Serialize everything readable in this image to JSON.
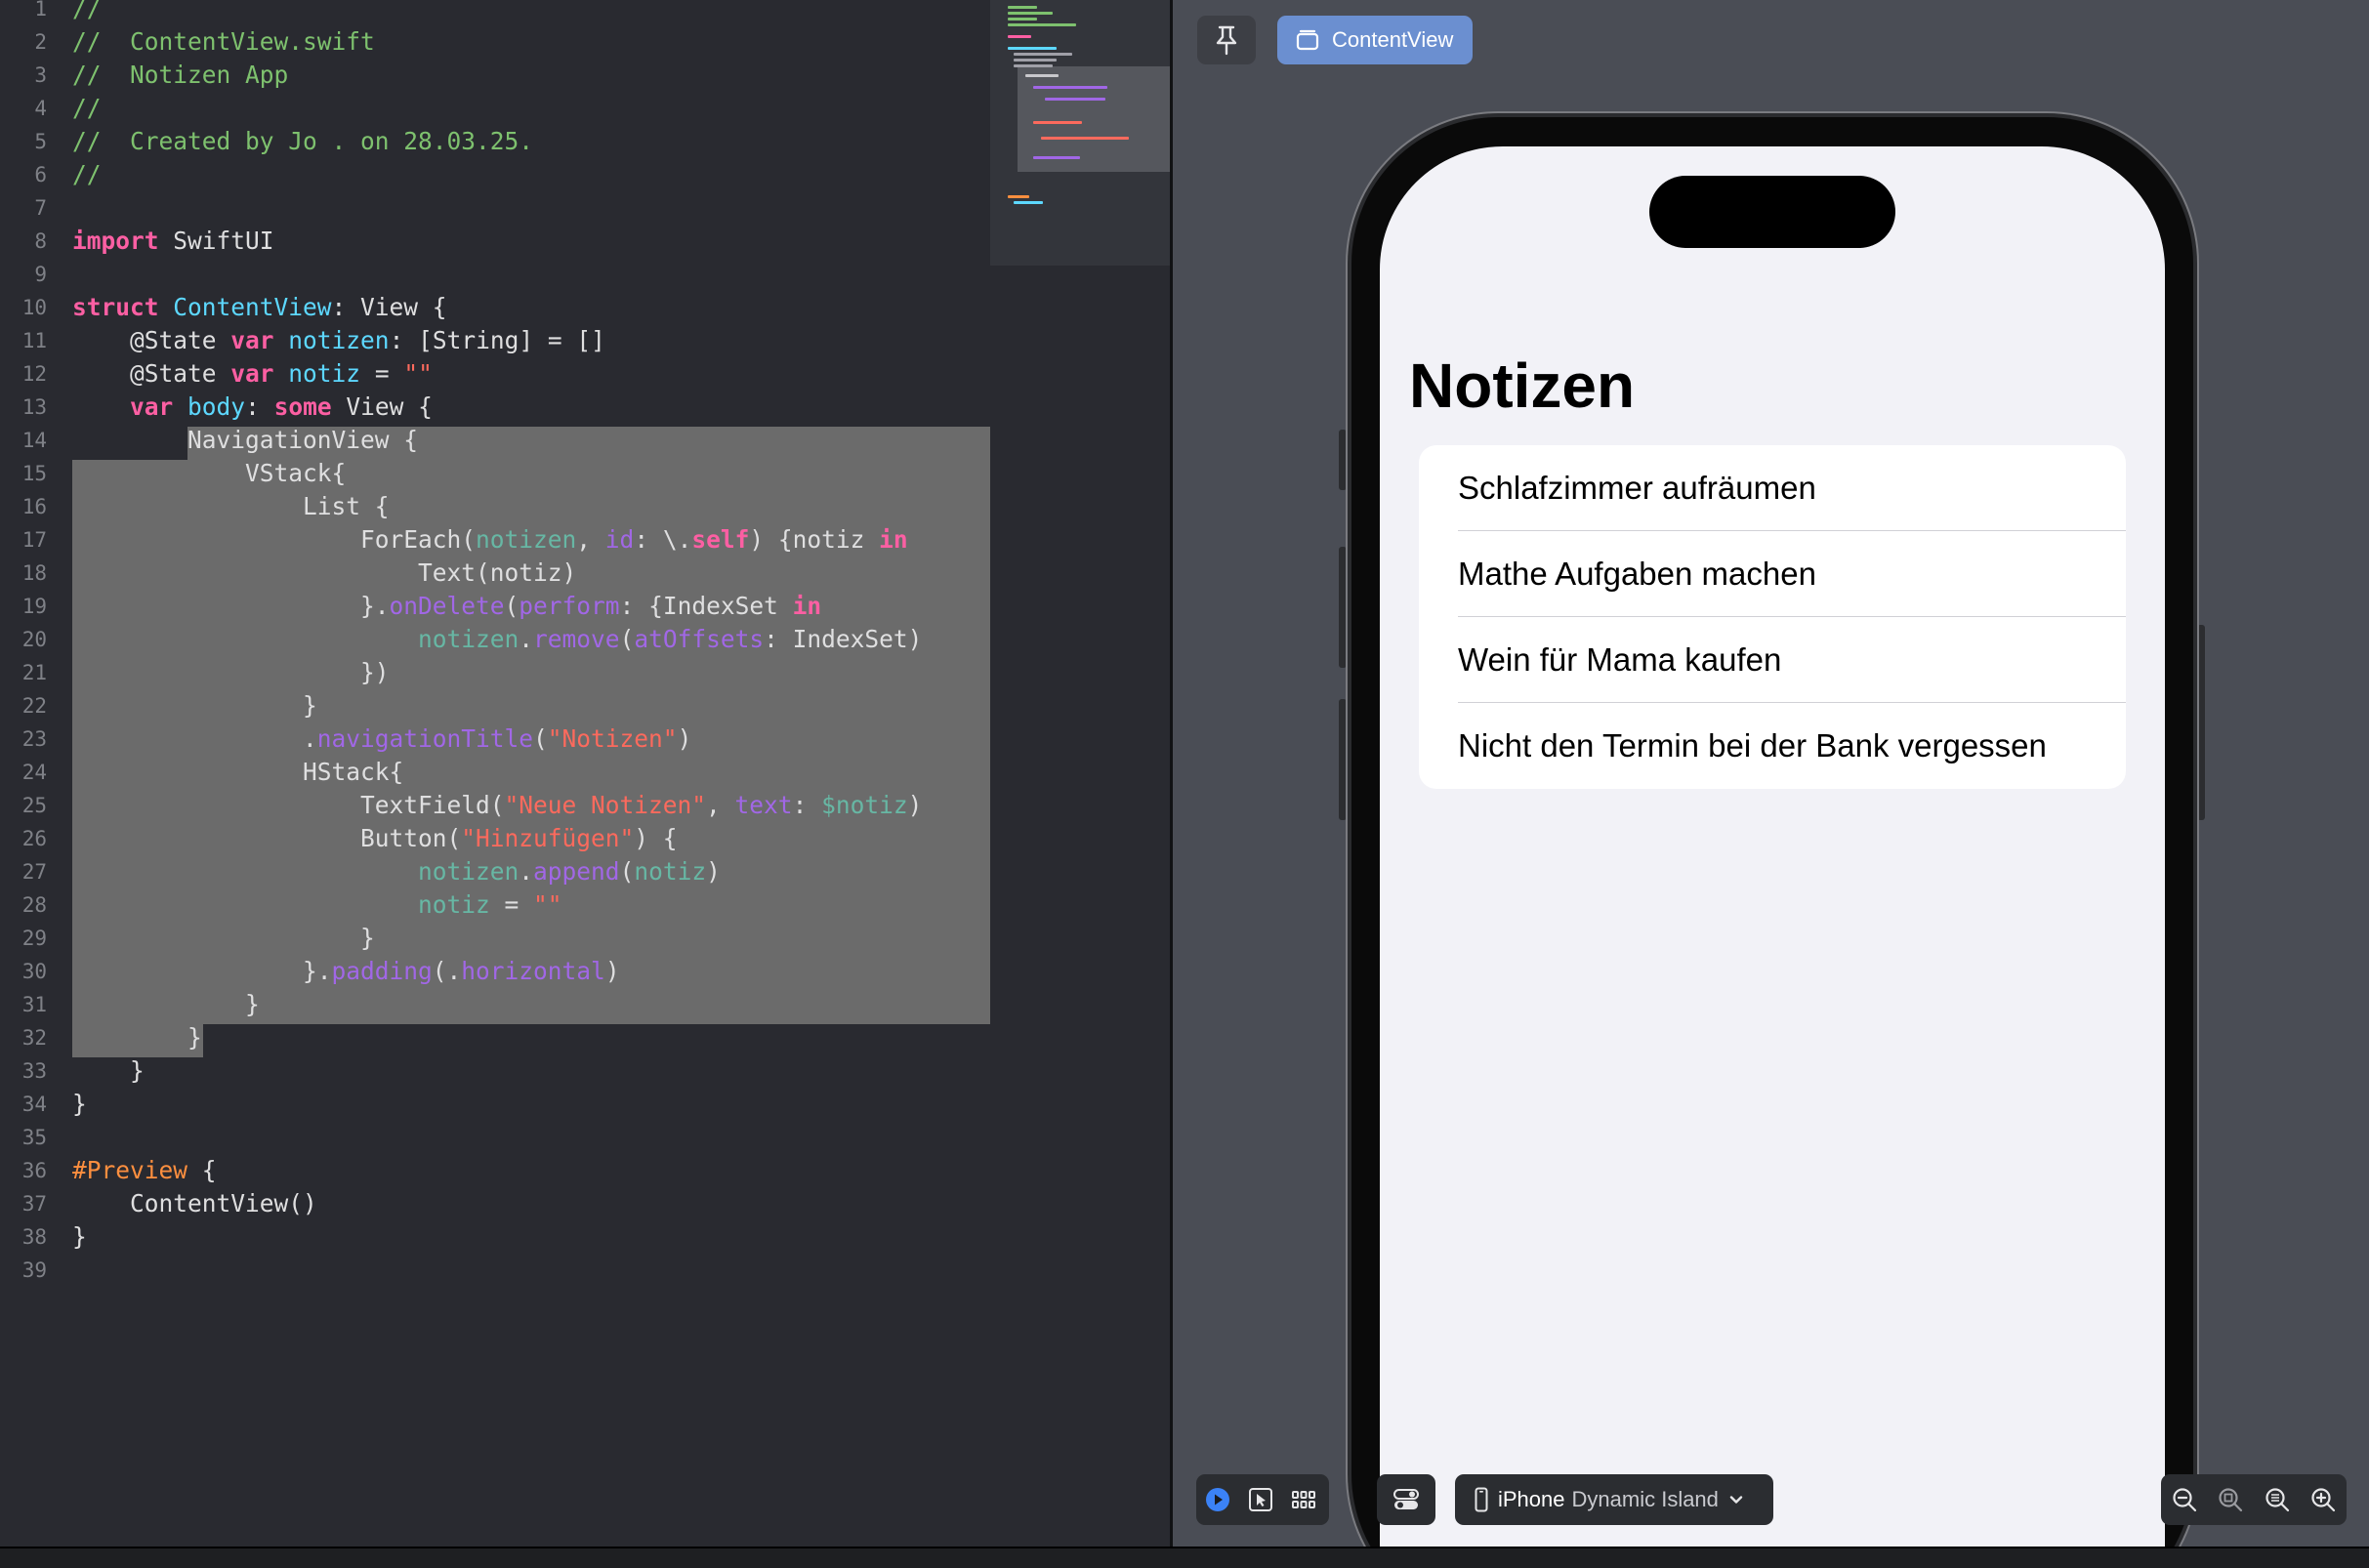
{
  "editor": {
    "file_name": "ContentView.swift",
    "lines": [
      {
        "n": "1",
        "tokens": [
          {
            "t": "//",
            "c": "cm"
          }
        ]
      },
      {
        "n": "2",
        "tokens": [
          {
            "t": "//  ContentView.swift",
            "c": "cm"
          }
        ]
      },
      {
        "n": "3",
        "tokens": [
          {
            "t": "//  Notizen App",
            "c": "cm"
          }
        ]
      },
      {
        "n": "4",
        "tokens": [
          {
            "t": "//",
            "c": "cm"
          }
        ]
      },
      {
        "n": "5",
        "tokens": [
          {
            "t": "//  Created by Jo . on 28.03.25.",
            "c": "cm"
          }
        ]
      },
      {
        "n": "6",
        "tokens": [
          {
            "t": "//",
            "c": "cm"
          }
        ]
      },
      {
        "n": "7",
        "tokens": []
      },
      {
        "n": "8",
        "tokens": [
          {
            "t": "import",
            "c": "kw"
          },
          {
            "t": " SwiftUI",
            "c": "pl"
          }
        ]
      },
      {
        "n": "9",
        "tokens": []
      },
      {
        "n": "10",
        "tokens": [
          {
            "t": "struct",
            "c": "kw"
          },
          {
            "t": " ",
            "c": "pl"
          },
          {
            "t": "ContentView",
            "c": "ty"
          },
          {
            "t": ": View {",
            "c": "pl"
          }
        ]
      },
      {
        "n": "11",
        "tokens": [
          {
            "t": "    @State ",
            "c": "pl"
          },
          {
            "t": "var",
            "c": "kw"
          },
          {
            "t": " ",
            "c": "pl"
          },
          {
            "t": "notizen",
            "c": "ty"
          },
          {
            "t": ": [String] = []",
            "c": "pl"
          }
        ]
      },
      {
        "n": "12",
        "tokens": [
          {
            "t": "    @State ",
            "c": "pl"
          },
          {
            "t": "var",
            "c": "kw"
          },
          {
            "t": " ",
            "c": "pl"
          },
          {
            "t": "notiz",
            "c": "ty"
          },
          {
            "t": " = ",
            "c": "pl"
          },
          {
            "t": "\"\"",
            "c": "st"
          }
        ]
      },
      {
        "n": "13",
        "tokens": [
          {
            "t": "    ",
            "c": "pl"
          },
          {
            "t": "var",
            "c": "kw"
          },
          {
            "t": " ",
            "c": "pl"
          },
          {
            "t": "body",
            "c": "ty"
          },
          {
            "t": ": ",
            "c": "pl"
          },
          {
            "t": "some",
            "c": "kw"
          },
          {
            "t": " View {",
            "c": "pl"
          }
        ]
      },
      {
        "n": "14",
        "tokens": [
          {
            "t": "        NavigationView {",
            "c": "pl"
          }
        ]
      },
      {
        "n": "15",
        "tokens": [
          {
            "t": "            VStack{",
            "c": "pl"
          }
        ]
      },
      {
        "n": "16",
        "tokens": [
          {
            "t": "                List {",
            "c": "pl"
          }
        ]
      },
      {
        "n": "17",
        "tokens": [
          {
            "t": "                    ForEach(",
            "c": "pl"
          },
          {
            "t": "notizen",
            "c": "vr"
          },
          {
            "t": ", ",
            "c": "pl"
          },
          {
            "t": "id",
            "c": "fn"
          },
          {
            "t": ": \\.",
            "c": "pl"
          },
          {
            "t": "self",
            "c": "kw"
          },
          {
            "t": ") {notiz ",
            "c": "pl"
          },
          {
            "t": "in",
            "c": "kw"
          }
        ]
      },
      {
        "n": "18",
        "tokens": [
          {
            "t": "                        Text(notiz)",
            "c": "pl"
          }
        ]
      },
      {
        "n": "19",
        "tokens": [
          {
            "t": "                    }.",
            "c": "pl"
          },
          {
            "t": "onDelete",
            "c": "fn"
          },
          {
            "t": "(",
            "c": "pl"
          },
          {
            "t": "perform",
            "c": "fn"
          },
          {
            "t": ": {IndexSet ",
            "c": "pl"
          },
          {
            "t": "in",
            "c": "kw"
          }
        ]
      },
      {
        "n": "20",
        "tokens": [
          {
            "t": "                        ",
            "c": "pl"
          },
          {
            "t": "notizen",
            "c": "vr"
          },
          {
            "t": ".",
            "c": "pl"
          },
          {
            "t": "remove",
            "c": "fn"
          },
          {
            "t": "(",
            "c": "pl"
          },
          {
            "t": "atOffsets",
            "c": "fn"
          },
          {
            "t": ": IndexSet)",
            "c": "pl"
          }
        ]
      },
      {
        "n": "21",
        "tokens": [
          {
            "t": "                    })",
            "c": "pl"
          }
        ]
      },
      {
        "n": "22",
        "tokens": [
          {
            "t": "                }",
            "c": "pl"
          }
        ]
      },
      {
        "n": "23",
        "tokens": [
          {
            "t": "                .",
            "c": "pl"
          },
          {
            "t": "navigationTitle",
            "c": "fn"
          },
          {
            "t": "(",
            "c": "pl"
          },
          {
            "t": "\"Notizen\"",
            "c": "st"
          },
          {
            "t": ")",
            "c": "pl"
          }
        ]
      },
      {
        "n": "24",
        "tokens": [
          {
            "t": "                HStack{",
            "c": "pl"
          }
        ]
      },
      {
        "n": "25",
        "tokens": [
          {
            "t": "                    TextField(",
            "c": "pl"
          },
          {
            "t": "\"Neue Notizen\"",
            "c": "st"
          },
          {
            "t": ", ",
            "c": "pl"
          },
          {
            "t": "text",
            "c": "fn"
          },
          {
            "t": ": ",
            "c": "pl"
          },
          {
            "t": "$notiz",
            "c": "vr"
          },
          {
            "t": ")",
            "c": "pl"
          }
        ]
      },
      {
        "n": "26",
        "tokens": [
          {
            "t": "                    Button(",
            "c": "pl"
          },
          {
            "t": "\"Hinzufügen\"",
            "c": "st"
          },
          {
            "t": ") {",
            "c": "pl"
          }
        ]
      },
      {
        "n": "27",
        "tokens": [
          {
            "t": "                        ",
            "c": "pl"
          },
          {
            "t": "notizen",
            "c": "vr"
          },
          {
            "t": ".",
            "c": "pl"
          },
          {
            "t": "append",
            "c": "fn"
          },
          {
            "t": "(",
            "c": "pl"
          },
          {
            "t": "notiz",
            "c": "vr"
          },
          {
            "t": ")",
            "c": "pl"
          }
        ]
      },
      {
        "n": "28",
        "tokens": [
          {
            "t": "                        ",
            "c": "pl"
          },
          {
            "t": "notiz",
            "c": "vr"
          },
          {
            "t": " = ",
            "c": "pl"
          },
          {
            "t": "\"\"",
            "c": "st"
          }
        ]
      },
      {
        "n": "29",
        "tokens": [
          {
            "t": "                    }",
            "c": "pl"
          }
        ]
      },
      {
        "n": "30",
        "tokens": [
          {
            "t": "                }.",
            "c": "pl"
          },
          {
            "t": "padding",
            "c": "fn"
          },
          {
            "t": "(.",
            "c": "pl"
          },
          {
            "t": "horizontal",
            "c": "fn"
          },
          {
            "t": ")",
            "c": "pl"
          }
        ]
      },
      {
        "n": "31",
        "tokens": [
          {
            "t": "            }",
            "c": "pl"
          }
        ]
      },
      {
        "n": "32",
        "tokens": [
          {
            "t": "        }",
            "c": "pl"
          }
        ]
      },
      {
        "n": "33",
        "tokens": [
          {
            "t": "    }",
            "c": "pl"
          }
        ]
      },
      {
        "n": "34",
        "tokens": [
          {
            "t": "}",
            "c": "pl"
          }
        ]
      },
      {
        "n": "35",
        "tokens": []
      },
      {
        "n": "36",
        "tokens": [
          {
            "t": "#Preview",
            "c": "pp"
          },
          {
            "t": " {",
            "c": "pl"
          }
        ]
      },
      {
        "n": "37",
        "tokens": [
          {
            "t": "    ContentView()",
            "c": "pl"
          }
        ]
      },
      {
        "n": "38",
        "tokens": [
          {
            "t": "}",
            "c": "pl"
          }
        ]
      },
      {
        "n": "39",
        "tokens": []
      }
    ]
  },
  "canvas": {
    "pin_icon": "pin-icon",
    "tab_label": "ContentView",
    "tab_icon": "window-stack-icon",
    "device_name": "iPhone",
    "device_variant": "Dynamic Island",
    "device_icon": "iphone-icon",
    "toolbar_icons": [
      "live-play-icon",
      "selectable-cursor-icon",
      "variants-grid-icon",
      "device-settings-icon",
      "zoom-out-icon",
      "zoom-fit-icon",
      "zoom-100-icon",
      "zoom-in-icon"
    ]
  },
  "preview": {
    "nav_title": "Notizen",
    "notes": [
      "Schlafzimmer aufräumen",
      "Mathe Aufgaben machen",
      "Wein für Mama kaufen",
      "Nicht den Termin bei der Bank vergessen"
    ]
  },
  "colors": {
    "editor_bg": "#292a30",
    "comment": "#7ec16e",
    "keyword": "#fc5fa3",
    "type": "#5dd8ff",
    "string": "#fc6a5d",
    "function": "#a167e6",
    "variable": "#67b7a4",
    "selection": "#6b6b6b",
    "canvas_bg": "#4a4d55",
    "tab_accent": "#6b8fd0"
  }
}
